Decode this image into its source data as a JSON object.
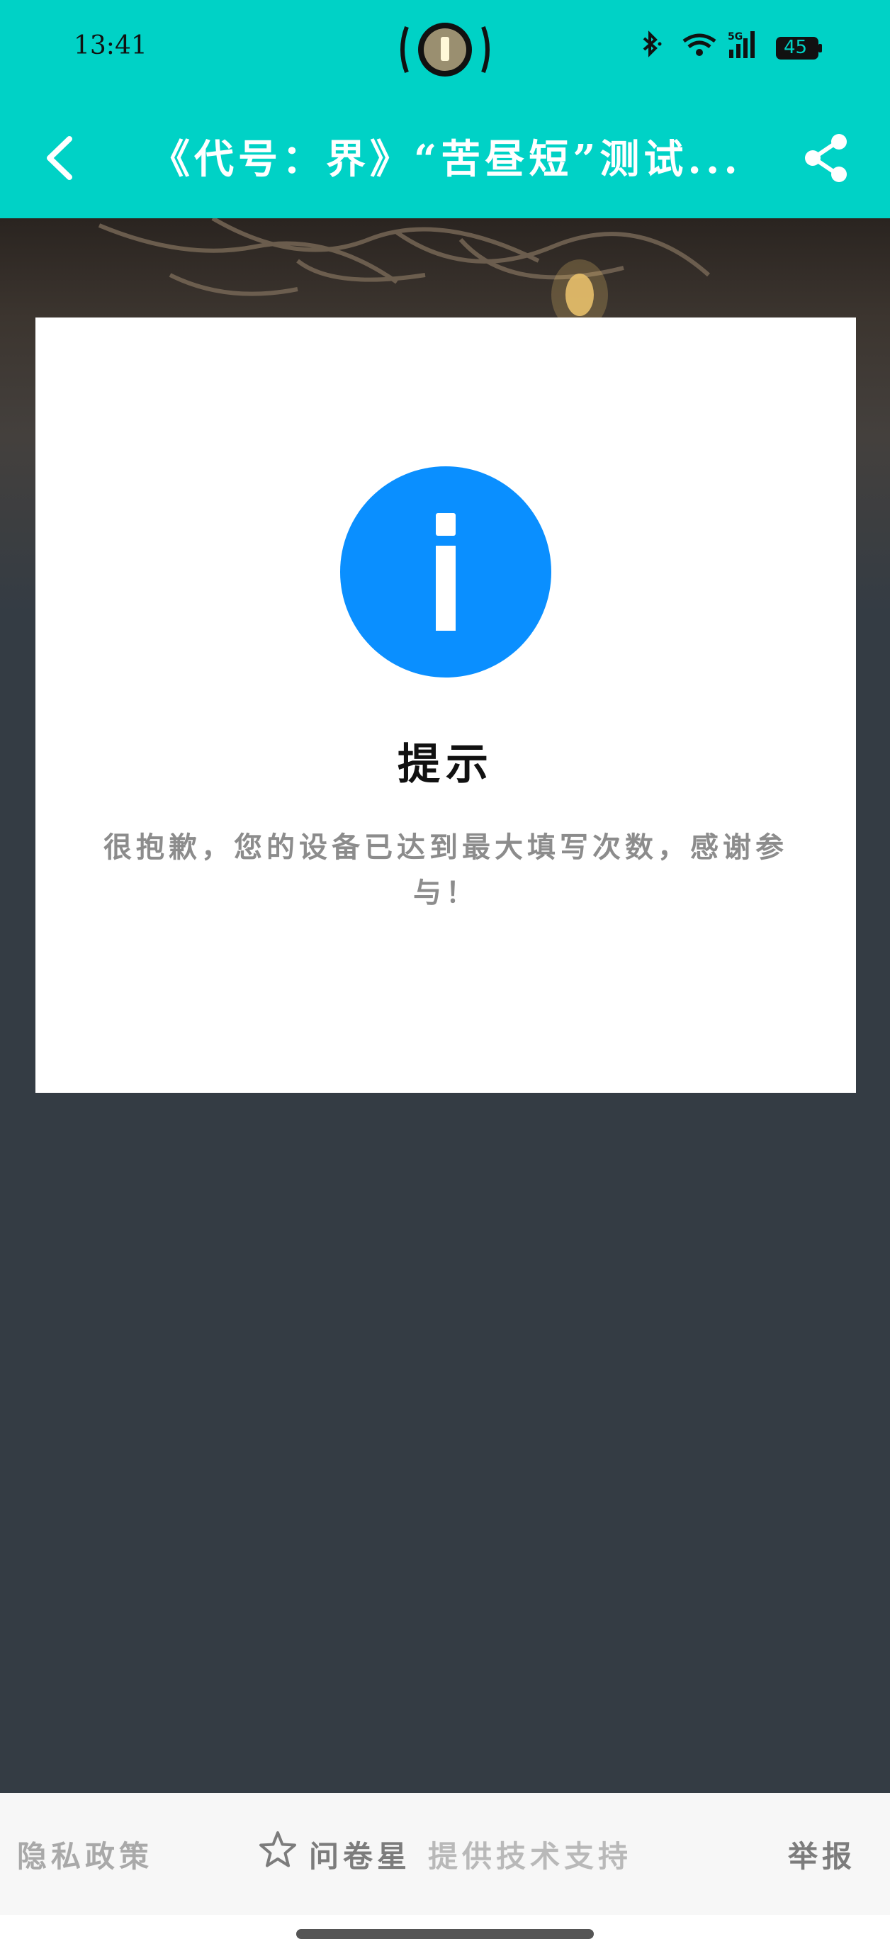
{
  "status": {
    "time": "13:41",
    "battery": "45",
    "network": "5G"
  },
  "header": {
    "title": "《代号：界》“苦昼短”测试..."
  },
  "card": {
    "title": "提示",
    "message": "很抱歉，您的设备已达到最大填写次数，感谢参与！"
  },
  "footer": {
    "privacy": "隐私政策",
    "brand": "问卷星",
    "support": "提供技术支持",
    "report": "举报"
  },
  "colors": {
    "header_bg": "#00d2c6",
    "page_bg": "#343c44",
    "info_blue": "#0a8fff"
  }
}
